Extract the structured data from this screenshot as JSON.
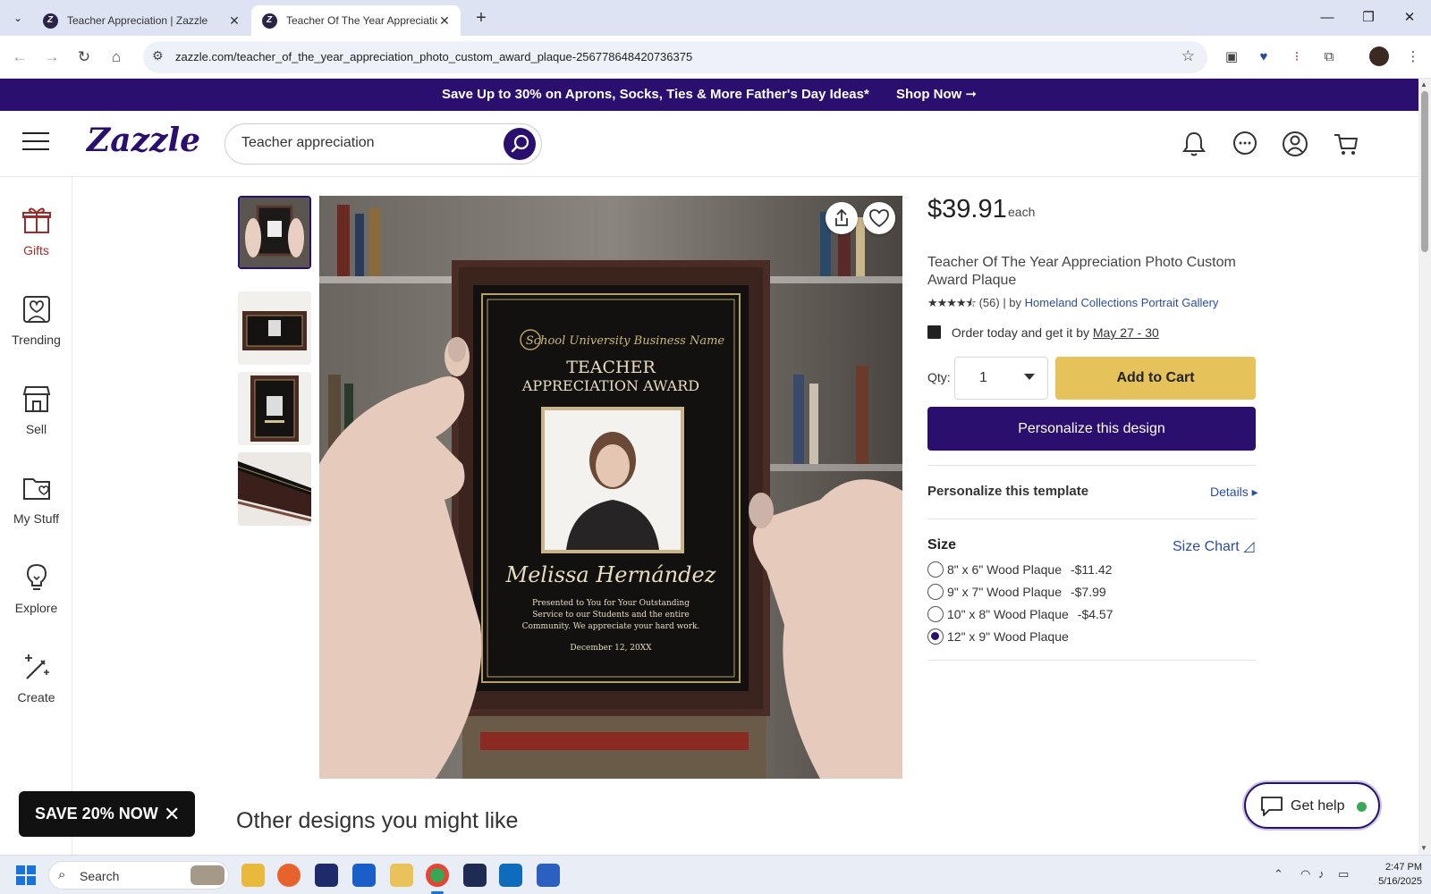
{
  "browser": {
    "tabs": [
      {
        "title": "Teacher Appreciation | Zazzle"
      },
      {
        "title": "Teacher Of The Year Appreciation I"
      }
    ],
    "url": "zazzle.com/teacher_of_the_year_appreciation_photo_custom_award_plaque-256778648420736375"
  },
  "promo": {
    "text": "Save Up to 30% on Aprons, Socks, Ties & More Father's Day Ideas*",
    "link": "Shop Now ➞"
  },
  "header": {
    "logo": "Zazzle",
    "search_value": "Teacher appreciation"
  },
  "sidebar": {
    "items": [
      {
        "label": "Gifts"
      },
      {
        "label": "Trending"
      },
      {
        "label": "Sell"
      },
      {
        "label": "My Stuff"
      },
      {
        "label": "Explore"
      },
      {
        "label": "Create"
      }
    ]
  },
  "plaque": {
    "org": "School University Business Name",
    "title1": "TEACHER",
    "title2": "APPRECIATION AWARD",
    "name": "Melissa Hernández",
    "body1": "Presented to You for Your Outstanding",
    "body2": "Service to our Students and the entire",
    "body3": "Community. We appreciate your hard work.",
    "date": "December 12, 20XX"
  },
  "product": {
    "price": "$39.91",
    "each": "each",
    "title": "Teacher Of The Year Appreciation Photo Custom Award Plaque",
    "stars": "★★★★⯪",
    "review_count": "(56)",
    "by": "| by",
    "seller": "Homeland Collections Portrait Gallery",
    "delivery_prefix": "Order today and get it by",
    "delivery_dates": "May 27 - 30",
    "qty_label": "Qty:",
    "qty_value": "1",
    "add_to_cart": "Add to Cart",
    "personalize_btn": "Personalize this design",
    "template_label": "Personalize this template",
    "details_link": "Details ▸",
    "size_label": "Size",
    "size_chart": "Size Chart ◿",
    "sizes": [
      {
        "label": "8\" x 6\" Wood Plaque",
        "delta": "-$11.42",
        "selected": false
      },
      {
        "label": "9\" x 7\" Wood Plaque",
        "delta": "-$7.99",
        "selected": false
      },
      {
        "label": "10\" x 8\" Wood Plaque",
        "delta": "-$4.57",
        "selected": false
      },
      {
        "label": "12\" x 9\" Wood Plaque",
        "delta": "",
        "selected": true
      }
    ]
  },
  "other_designs": "Other designs you might like",
  "save_popup": "SAVE 20% NOW",
  "get_help": "Get help",
  "taskbar": {
    "search_label": "Search",
    "time": "2:47 PM",
    "date": "5/16/2025"
  },
  "colors": {
    "brand": "#2a0f6e",
    "add_to_cart": "#e6c25a",
    "link": "#2a4da0"
  }
}
